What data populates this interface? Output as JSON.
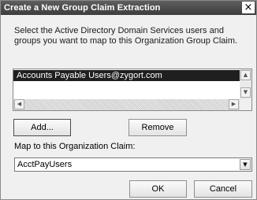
{
  "window": {
    "title": "Create a New Group Claim Extraction",
    "close_glyph": "×"
  },
  "description": "Select the Active Directory Domain Services users and groups you want to map to this Organization Group Claim.",
  "list": {
    "items": [
      {
        "label": "Accounts Payable Users@zygort.com",
        "selected": true
      }
    ]
  },
  "buttons": {
    "add": "Add...",
    "remove": "Remove",
    "ok": "OK",
    "cancel": "Cancel"
  },
  "map": {
    "label": "Map to this Organization Claim:",
    "selected": "AcctPayUsers"
  },
  "icons": {
    "scroll_up": "arrow-up-icon",
    "scroll_down": "arrow-down-icon",
    "scroll_left": "arrow-left-icon",
    "scroll_right": "arrow-right-icon",
    "combo": "chevron-down-icon"
  },
  "colors": {
    "titlebar": "#3d3d3d",
    "selection": "#1f1f1f",
    "dialog_bg": "#f0f0f0"
  }
}
